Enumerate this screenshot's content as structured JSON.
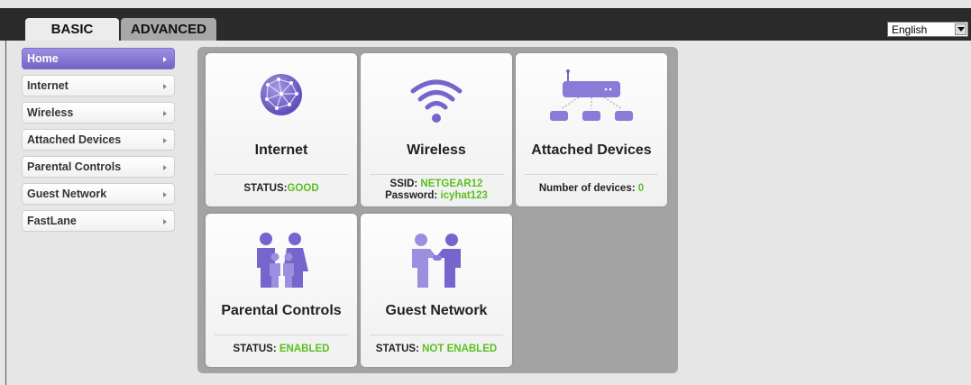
{
  "tabs": {
    "basic": "BASIC",
    "advanced": "ADVANCED"
  },
  "language": {
    "selected": "English"
  },
  "sidebar": {
    "items": [
      {
        "label": "Home"
      },
      {
        "label": "Internet"
      },
      {
        "label": "Wireless"
      },
      {
        "label": "Attached Devices"
      },
      {
        "label": "Parental Controls"
      },
      {
        "label": "Guest Network"
      },
      {
        "label": "FastLane"
      }
    ]
  },
  "cards": {
    "internet": {
      "title": "Internet",
      "status_label": "STATUS:",
      "status_value": "GOOD",
      "icon": "globe-icon"
    },
    "wireless": {
      "title": "Wireless",
      "ssid_label": "SSID:",
      "ssid_value": "NETGEAR12",
      "password_label": "Password:",
      "password_value": "icyhat123",
      "icon": "wifi-icon"
    },
    "attached": {
      "title": "Attached Devices",
      "devices_label": "Number of devices:",
      "devices_value": "0",
      "icon": "router-icon"
    },
    "parental": {
      "title": "Parental Controls",
      "status_label": "STATUS:",
      "status_value": "ENABLED",
      "icon": "family-icon"
    },
    "guest": {
      "title": "Guest Network",
      "status_label": "STATUS:",
      "status_value": "NOT ENABLED",
      "icon": "guest-people-icon"
    }
  },
  "colors": {
    "accent_purple": "#7b6bd0",
    "status_green": "#5cbf1f",
    "topbar": "#2b2b2b"
  }
}
